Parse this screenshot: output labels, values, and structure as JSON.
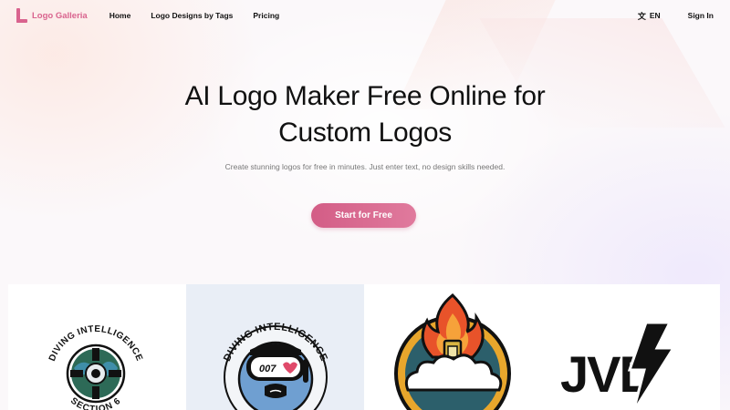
{
  "brand": {
    "name": "Logo Galleria",
    "color": "#d9638e"
  },
  "nav": {
    "items": [
      {
        "label": "Home"
      },
      {
        "label": "Logo Designs by Tags"
      },
      {
        "label": "Pricing"
      }
    ]
  },
  "header_right": {
    "language": "EN",
    "language_icon": "translate-icon",
    "sign_in": "Sign In"
  },
  "hero": {
    "title_line1": "AI Logo Maker Free Online for",
    "title_line2": "Custom Logos",
    "subtitle": "Create stunning logos for free in minutes. Just enter text, no design skills needed.",
    "cta_label": "Start for Free",
    "cta_color": "#d35d86"
  },
  "gallery": {
    "cards": [
      {
        "top_text": "DIVING INTELLIGENCE",
        "bottom_text": "SECTION 6"
      },
      {
        "top_text": "DIVING INTELLIGENCE",
        "badge_text": "007"
      },
      {
        "image": "fire-canister-logo"
      },
      {
        "text": "JVD"
      }
    ]
  }
}
